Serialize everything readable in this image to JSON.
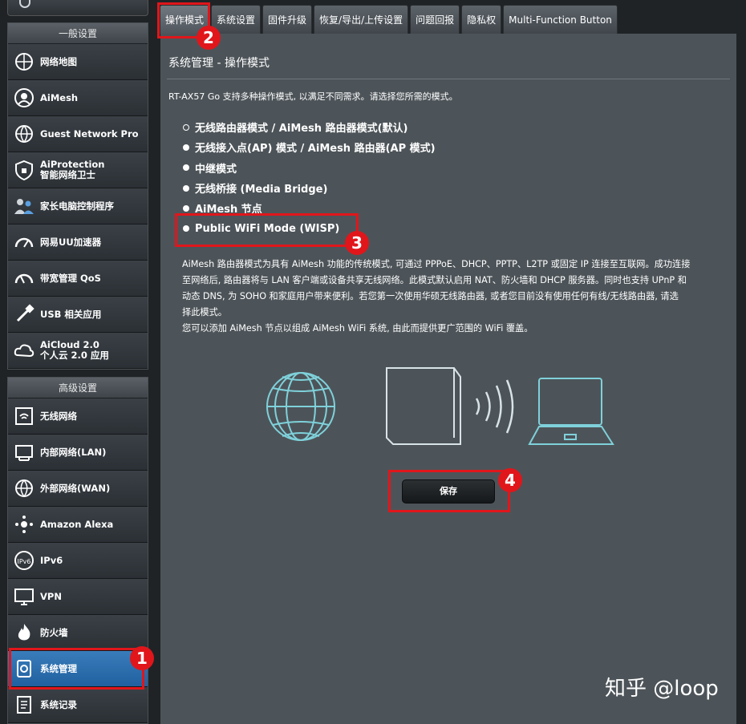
{
  "sidebar": {
    "general_heading": "一般设置",
    "general_items": [
      {
        "label": "网络地图",
        "icon": "network-map-icon"
      },
      {
        "label": "AiMesh",
        "icon": "aimesh-icon"
      },
      {
        "label": "Guest Network Pro",
        "icon": "guest-network-icon"
      },
      {
        "label": "AiProtection\n智能网络卫士",
        "icon": "shield-icon"
      },
      {
        "label": "家长电脑控制程序",
        "icon": "family-icon"
      },
      {
        "label": "网易UU加速器",
        "icon": "gauge-icon"
      },
      {
        "label": "带宽管理 QoS",
        "icon": "speedometer-icon"
      },
      {
        "label": "USB 相关应用",
        "icon": "usb-icon"
      },
      {
        "label": "AiCloud 2.0\n个人云 2.0 应用",
        "icon": "cloud-icon"
      }
    ],
    "advanced_heading": "高级设置",
    "advanced_items": [
      {
        "label": "无线网络",
        "icon": "wifi-icon"
      },
      {
        "label": "内部网络(LAN)",
        "icon": "lan-icon"
      },
      {
        "label": "外部网络(WAN)",
        "icon": "globe-icon"
      },
      {
        "label": "Amazon Alexa",
        "icon": "alexa-icon"
      },
      {
        "label": "IPv6",
        "icon": "ipv6-icon"
      },
      {
        "label": "VPN",
        "icon": "vpn-icon"
      },
      {
        "label": "防火墙",
        "icon": "firewall-icon"
      },
      {
        "label": "系统管理",
        "icon": "admin-icon",
        "active": true
      },
      {
        "label": "系统记录",
        "icon": "log-icon"
      }
    ]
  },
  "tabs": [
    "操作模式",
    "系统设置",
    "固件升级",
    "恢复/导出/上传设置",
    "问题回报",
    "隐私权",
    "Multi-Function Button"
  ],
  "panel": {
    "title": "系统管理 - 操作模式",
    "description": "RT-AX57 Go 支持多种操作模式, 以满足不同需求。请选择您所需的模式。",
    "options": [
      "无线路由器模式 / AiMesh 路由器模式(默认)",
      "无线接入点(AP) 模式 / AiMesh 路由器(AP 模式)",
      "中继模式",
      "无线桥接 (Media Bridge)",
      "AiMesh 节点",
      "Public WiFi Mode (WISP)"
    ],
    "selected_index": 0,
    "explanation_lines": [
      "AiMesh 路由器模式为具有 AiMesh 功能的传统模式, 可通过 PPPoE、DHCP、PPTP、L2TP 或固定 IP 连接至互联网。成功连接",
      "至网络后, 路由器将与 LAN 客户端或设备共享无线网络。此模式默认启用 NAT、防火墙和 DHCP 服务器。同时也支持 UPnP 和",
      "动态 DNS, 为 SOHO 和家庭用户带来便利。若您第一次使用华硕无线路由器, 或者您目前没有使用任何有线/无线路由器, 请选",
      "择此模式。",
      "您可以添加 AiMesh 节点以组成 AiMesh WiFi 系统, 由此而提供更广范围的 WiFi 覆盖。"
    ],
    "save_label": "保存"
  },
  "annotations": [
    "1",
    "2",
    "3",
    "4"
  ],
  "watermark": "知乎 @loop",
  "colors": {
    "accent_red": "#e0161b",
    "panel_bg": "#4d5459",
    "active_blue": "#2f6fae"
  }
}
